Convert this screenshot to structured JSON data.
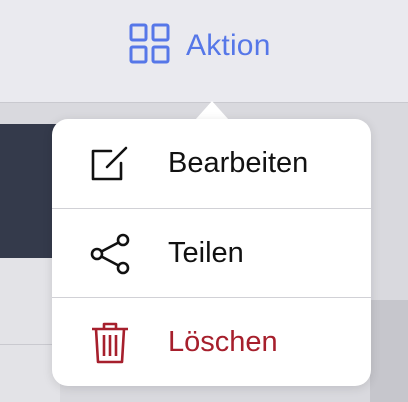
{
  "toolbar": {
    "action_label": "Aktion",
    "action_icon": "grid-icon",
    "accent_color": "#5677e8"
  },
  "menu": {
    "items": [
      {
        "label": "Bearbeiten",
        "icon": "edit-icon"
      },
      {
        "label": "Teilen",
        "icon": "share-icon"
      },
      {
        "label": "Löschen",
        "icon": "trash-icon",
        "color": "#a61f2c"
      }
    ]
  }
}
